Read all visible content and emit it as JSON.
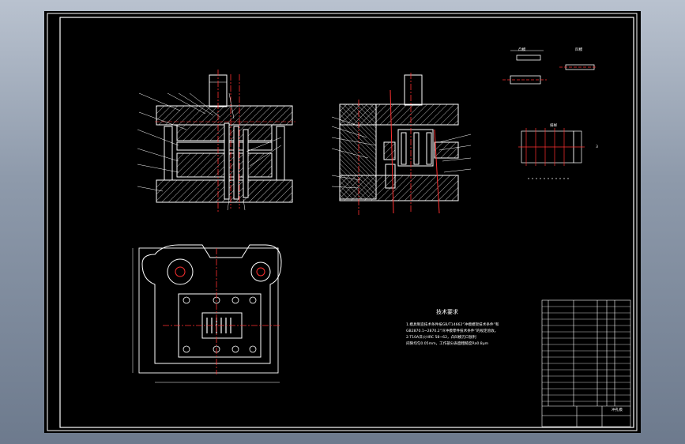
{
  "drawing": {
    "tech_requirements": {
      "title": "技术要求",
      "lines": [
        "1.模具制造技术条件按GB/T14662“冲模模架技术条件”和",
        "GB2870.1~2870.2“冷冲模零件技术条件”的规定验收。",
        "2.T10A淬火HRC 58~62，凸凹模刃口锐利",
        "间隙均匀0.05mm，工作部分表面粗糙度Ra0.8μm"
      ]
    },
    "view_labels": {
      "top_right_a": "凹模",
      "top_right_b": "凸模",
      "mid_right": "排样",
      "side_mark": "3"
    },
    "title_block": {
      "drawing_name": "冲孔模"
    }
  }
}
